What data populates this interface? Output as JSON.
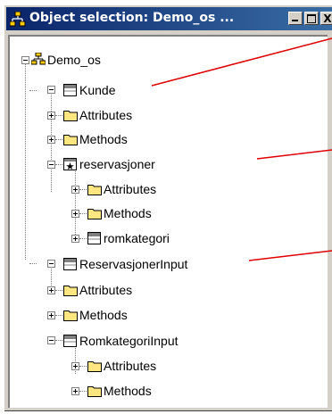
{
  "window": {
    "title": "Object selection: Demo_os ...",
    "buttons": {
      "minimize": "_",
      "maximize": "□",
      "close": "X"
    }
  },
  "tree": {
    "root": {
      "label": "Demo_os",
      "icon": "package-icon",
      "expanded": true
    },
    "nodes": [
      {
        "label": "Kunde",
        "icon": "class-icon",
        "expanded": true
      },
      {
        "label": "Attributes",
        "icon": "folder-icon",
        "expanded": false
      },
      {
        "label": "Methods",
        "icon": "folder-icon",
        "expanded": false
      },
      {
        "label": "reservasjoner",
        "icon": "relation-class-icon",
        "expanded": true
      },
      {
        "label": "Attributes",
        "icon": "folder-icon",
        "expanded": false
      },
      {
        "label": "Methods",
        "icon": "folder-icon",
        "expanded": false
      },
      {
        "label": "romkategori",
        "icon": "class-icon",
        "expanded": false
      },
      {
        "label": "ReservasjonerInput",
        "icon": "class-icon",
        "expanded": true
      },
      {
        "label": "Attributes",
        "icon": "folder-icon",
        "expanded": false
      },
      {
        "label": "Methods",
        "icon": "folder-icon",
        "expanded": false
      },
      {
        "label": "RomkategoriInput",
        "icon": "class-icon",
        "expanded": true
      },
      {
        "label": "Attributes",
        "icon": "folder-icon",
        "expanded": false
      },
      {
        "label": "Methods",
        "icon": "folder-icon",
        "expanded": false
      }
    ]
  },
  "colors": {
    "titlebar_start": "#0a246a",
    "titlebar_end": "#3a6ea5",
    "folder": "#ffe680",
    "callout_line": "#e00000"
  }
}
